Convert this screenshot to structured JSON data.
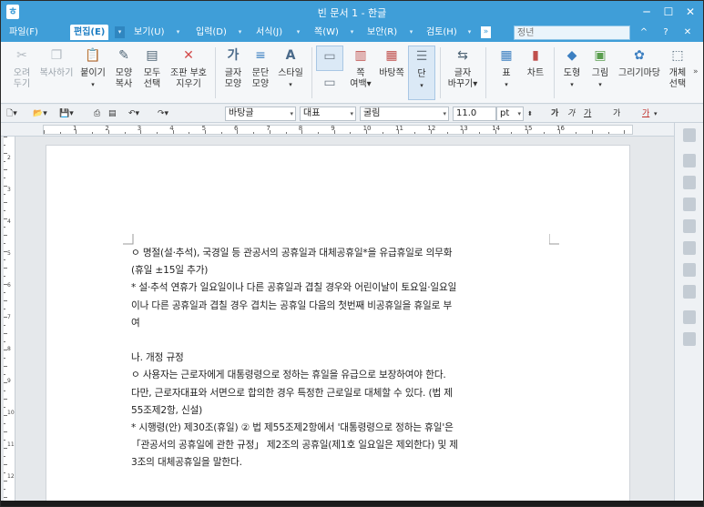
{
  "window": {
    "title": "빈 문서 1 - 한글",
    "app_icon": "ㅎ",
    "minimize_icon": "─",
    "maximize_icon": "☐",
    "close_icon": "✕"
  },
  "menu": {
    "items": [
      "파일(F)",
      "편집(E)",
      "보기(U)",
      "입력(D)",
      "서식(J)",
      "쪽(W)",
      "보안(R)",
      "검토(H)"
    ],
    "active_index": 1,
    "style_search_placeholder": "정년",
    "tail_icons": [
      "^",
      "?",
      "✕"
    ]
  },
  "ribbon": {
    "buttons": [
      {
        "label1": "오려",
        "label2": "두기",
        "icon": "scissors-icon",
        "glyph": "✂",
        "color": "#c7ccd1",
        "enabled": false
      },
      {
        "label1": "복사하기",
        "label2": "",
        "icon": "copy-icon",
        "glyph": "❐",
        "color": "#c7ccd1",
        "enabled": false
      },
      {
        "label1": "붙이기",
        "label2": "▾",
        "icon": "paste-icon",
        "glyph": "📋",
        "color": "#c9954a",
        "enabled": true
      },
      {
        "label1": "모양",
        "label2": "복사",
        "icon": "format-painter-icon",
        "glyph": "✎",
        "color": "#6b7d8c",
        "enabled": true
      },
      {
        "label1": "모두",
        "label2": "선택",
        "icon": "select-all-icon",
        "glyph": "▤",
        "color": "#6b7d8c",
        "enabled": true
      },
      {
        "label1": "조판 부호",
        "label2": "지우기",
        "icon": "erase-marks-icon",
        "glyph": "✕",
        "color": "#d34b4b",
        "enabled": true
      },
      {
        "label1": "글자",
        "label2": "모양",
        "icon": "char-shape-icon",
        "glyph": "가",
        "color": "#5a7ea0",
        "enabled": true
      },
      {
        "label1": "문단",
        "label2": "모양",
        "icon": "para-shape-icon",
        "glyph": "≡",
        "color": "#3c7fc1",
        "enabled": true
      },
      {
        "label1": "스타일",
        "label2": "▾",
        "icon": "style-icon",
        "glyph": "A",
        "color": "#5a7ea0",
        "enabled": true
      },
      {
        "label1": "",
        "label2": "",
        "icon": "page-icon",
        "glyph": "▭",
        "color": "#8e9aa5",
        "enabled": true
      },
      {
        "label1": "쪽",
        "label2": "여백▾",
        "icon": "margin-icon",
        "glyph": "▥",
        "color": "#c0504d",
        "enabled": true
      },
      {
        "label1": "바탕쪽",
        "label2": "",
        "icon": "master-page-icon",
        "glyph": "▦",
        "color": "#c0504d",
        "enabled": true
      },
      {
        "label1": "단",
        "label2": "▾",
        "icon": "columns-icon",
        "glyph": "☰",
        "color": "#8e9aa5",
        "enabled": true
      },
      {
        "label1": "글자",
        "label2": "바꾸기▾",
        "icon": "replace-char-icon",
        "glyph": "⇆",
        "color": "#6b7d8c",
        "enabled": true
      },
      {
        "label1": "표",
        "label2": "▾",
        "icon": "table-icon",
        "glyph": "▦",
        "color": "#3c7fc1",
        "enabled": true
      },
      {
        "label1": "차트",
        "label2": "",
        "icon": "chart-icon",
        "glyph": "▮",
        "color": "#c0504d",
        "enabled": true
      },
      {
        "label1": "도형",
        "label2": "▾",
        "icon": "shape-icon",
        "glyph": "◆",
        "color": "#3c7fc1",
        "enabled": true
      },
      {
        "label1": "그림",
        "label2": "▾",
        "icon": "picture-icon",
        "glyph": "▣",
        "color": "#5a9e4f",
        "enabled": true
      },
      {
        "label1": "그리기마당",
        "label2": "",
        "icon": "drawing-gallery-icon",
        "glyph": "✿",
        "color": "#3c7fc1",
        "enabled": true
      },
      {
        "label1": "개체",
        "label2": "선택",
        "icon": "object-select-icon",
        "glyph": "⬚",
        "color": "#6b7d8c",
        "enabled": true
      }
    ]
  },
  "format_bar": {
    "style": "바탕글",
    "language": "대표",
    "font": "굴림",
    "font_size": "11.0",
    "unit": "pt",
    "char_buttons": [
      "가",
      "가",
      "가",
      "가",
      "가"
    ]
  },
  "ruler": {
    "numbers": [
      "1",
      "2",
      "3",
      "4",
      "5",
      "6",
      "7",
      "8",
      "9",
      "10",
      "11",
      "12",
      "13",
      "14",
      "15",
      "16"
    ]
  },
  "vruler": {
    "numbers": [
      "2",
      "3",
      "4",
      "5",
      "6",
      "7",
      "8",
      "9",
      "10",
      "11",
      "12"
    ]
  },
  "document": {
    "lines": [
      "ㅇ 명절(설·추석), 국경일 등 관공서의 공휴일과 대체공휴일*을 유급휴일로 의무화",
      "(휴일 ±15일 추가)",
      "* 설·추석 연휴가 일요일이나 다른 공휴일과 겹칠 경우와 어린이날이 토요일·일요일",
      "이나 다른 공휴일과 겹칠 경우 겹치는 공휴일 다음의 첫번째 비공휴일을 휴일로 부",
      "여",
      "",
      "나. 개정 규정",
      "ㅇ 사용자는 근로자에게 대통령령으로 정하는 휴일을 유급으로 보장하여야 한다.",
      "다만, 근로자대표와 서면으로 합의한 경우 특정한 근로일로 대체할 수 있다. (법 제",
      "55조제2항, 신설)",
      "* 시행령(안) 제30조(휴일) ② 법 제55조제2항에서 '대통령령으로 정하는 휴일'은",
      "「관공서의 공휴일에 관한 규정」 제2조의 공휴일(제1호 일요일은 제외한다) 및 제",
      "3조의 대체공휴일을 말한다."
    ]
  }
}
